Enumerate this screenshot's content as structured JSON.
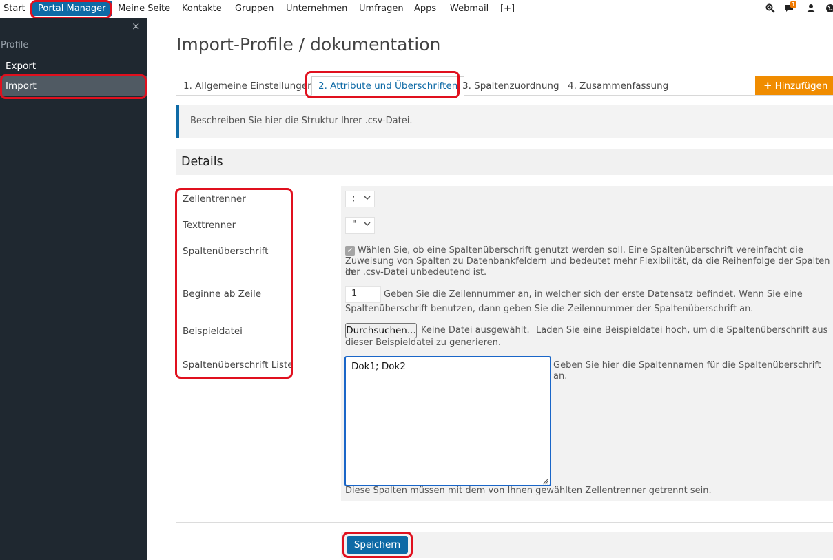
{
  "topnav": {
    "items": [
      {
        "label": "Start"
      },
      {
        "label": "Portal Manager",
        "active": true
      },
      {
        "label": "Meine Seite"
      },
      {
        "label": "Kontakte"
      },
      {
        "label": "Gruppen"
      },
      {
        "label": "Unternehmen"
      },
      {
        "label": "Umfragen"
      },
      {
        "label": "Apps"
      },
      {
        "label": "Webmail"
      },
      {
        "label": "[+]"
      }
    ],
    "icons": [
      "search-plus-icon",
      "chat-icon",
      "user-icon",
      "globe-icon"
    ],
    "chat_badge": "1"
  },
  "sidebar": {
    "close": "×",
    "section": "Profile",
    "items": [
      {
        "label": "Export"
      },
      {
        "label": "Import",
        "selected": true
      }
    ]
  },
  "page": {
    "title": "Import-Profile / dokumentation",
    "tabs": [
      {
        "label": "1. Allgemeine Einstellungen"
      },
      {
        "label": "2. Attribute und Überschriften",
        "active": true
      },
      {
        "label": "3. Spaltenzuordnung"
      },
      {
        "label": "4. Zusammenfassung"
      }
    ],
    "add_button": "Hinzufügen",
    "info": "Beschreiben Sie hier die Struktur Ihrer .csv-Datei.",
    "details_title": "Details"
  },
  "form": {
    "zellentrenner": {
      "label": "Zellentrenner",
      "value": ";"
    },
    "texttrenner": {
      "label": "Texttrenner",
      "value": "\""
    },
    "spaltenueberschrift": {
      "label": "Spaltenüberschrift",
      "checked": true,
      "help_lines": [
        "Wählen Sie, ob eine Spaltenüberschrift genutzt werden soll. Eine Spaltenüberschrift vereinfacht die",
        "Zuweisung von Spalten zu Datenbankfeldern und bedeutet mehr Flexibilität, da die Reihenfolge der Spalten in",
        "der .csv-Datei unbedeutend ist."
      ]
    },
    "beginne_ab_zeile": {
      "label": "Beginne ab Zeile",
      "value": "1",
      "help_lines": [
        "Geben Sie die Zeilennummer an, in welcher sich der erste Datensatz befindet. Wenn Sie eine",
        "Spaltenüberschrift benutzen, dann geben Sie die Zeilennummer der Spaltenüberschrift an."
      ]
    },
    "beispieldatei": {
      "label": "Beispieldatei",
      "button": "Durchsuchen...",
      "status": "Keine Datei ausgewählt.",
      "help_lines": [
        "Laden Sie eine Beispieldatei hoch, um die Spaltenüberschrift aus",
        "dieser Beispieldatei zu generieren."
      ]
    },
    "spaltenueberschrift_liste": {
      "label": "Spaltenüberschrift Liste",
      "value": "Dok1; Dok2",
      "help": "Geben Sie hier die Spaltennamen für die Spaltenüberschrift an.",
      "note": "Diese Spalten müssen mit dem von Ihnen gewählten Zellentrenner getrennt sein."
    },
    "save_button": "Speichern"
  },
  "colors": {
    "accent": "#0e6aa6",
    "add_button": "#f08c00",
    "sidebar_bg": "#1f2830",
    "highlight_ring": "#e0101e"
  }
}
